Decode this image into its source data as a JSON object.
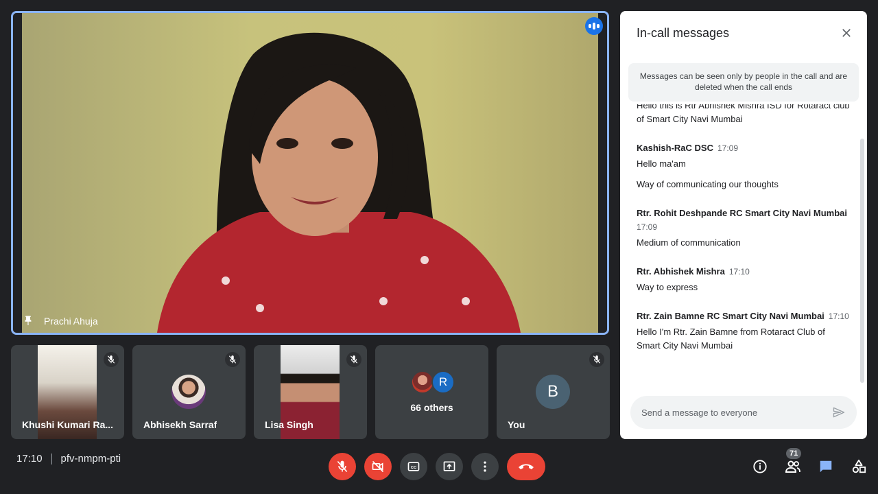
{
  "main_speaker": {
    "name": "Prachi Ahuja"
  },
  "tiles": [
    {
      "name": "Khushi Kumari Ra..."
    },
    {
      "name": "Abhisekh Sarraf"
    },
    {
      "name": "Lisa Singh"
    },
    {
      "name": "66 others",
      "avatar_letter": "R"
    },
    {
      "name": "You",
      "avatar_letter": "B"
    }
  ],
  "chat": {
    "title": "In-call messages",
    "notice": "Messages can be seen only by people in the call and are deleted when the call ends",
    "partial_message": "Hello this is Rtr Abhishek Mishra ISD for Rotaract club of Smart City Navi Mumbai",
    "messages": [
      {
        "sender": "Kashish-RaC DSC",
        "time": "17:09",
        "texts": [
          "Hello ma'am",
          "Way of communicating our thoughts"
        ]
      },
      {
        "sender": "Rtr. Rohit Deshpande RC Smart City Navi Mumbai",
        "time": "17:09",
        "texts": [
          "Medium of communication"
        ]
      },
      {
        "sender": "Rtr. Abhishek Mishra",
        "time": "17:10",
        "texts": [
          "Way to express"
        ]
      },
      {
        "sender": "Rtr. Zain Bamne RC Smart City Navi Mumbai",
        "time": "17:10",
        "texts": [
          "Hello I'm Rtr. Zain Bamne from Rotaract Club of Smart City Navi Mumbai"
        ]
      }
    ],
    "input_placeholder": "Send a message to everyone"
  },
  "bottom_bar": {
    "time": "17:10",
    "meeting_code": "pfv-nmpm-pti",
    "participant_count": "71"
  },
  "colors": {
    "accent": "#8ab4f8",
    "danger": "#ea4335",
    "chat_active": "#8ab4f8",
    "background": "#202124"
  }
}
